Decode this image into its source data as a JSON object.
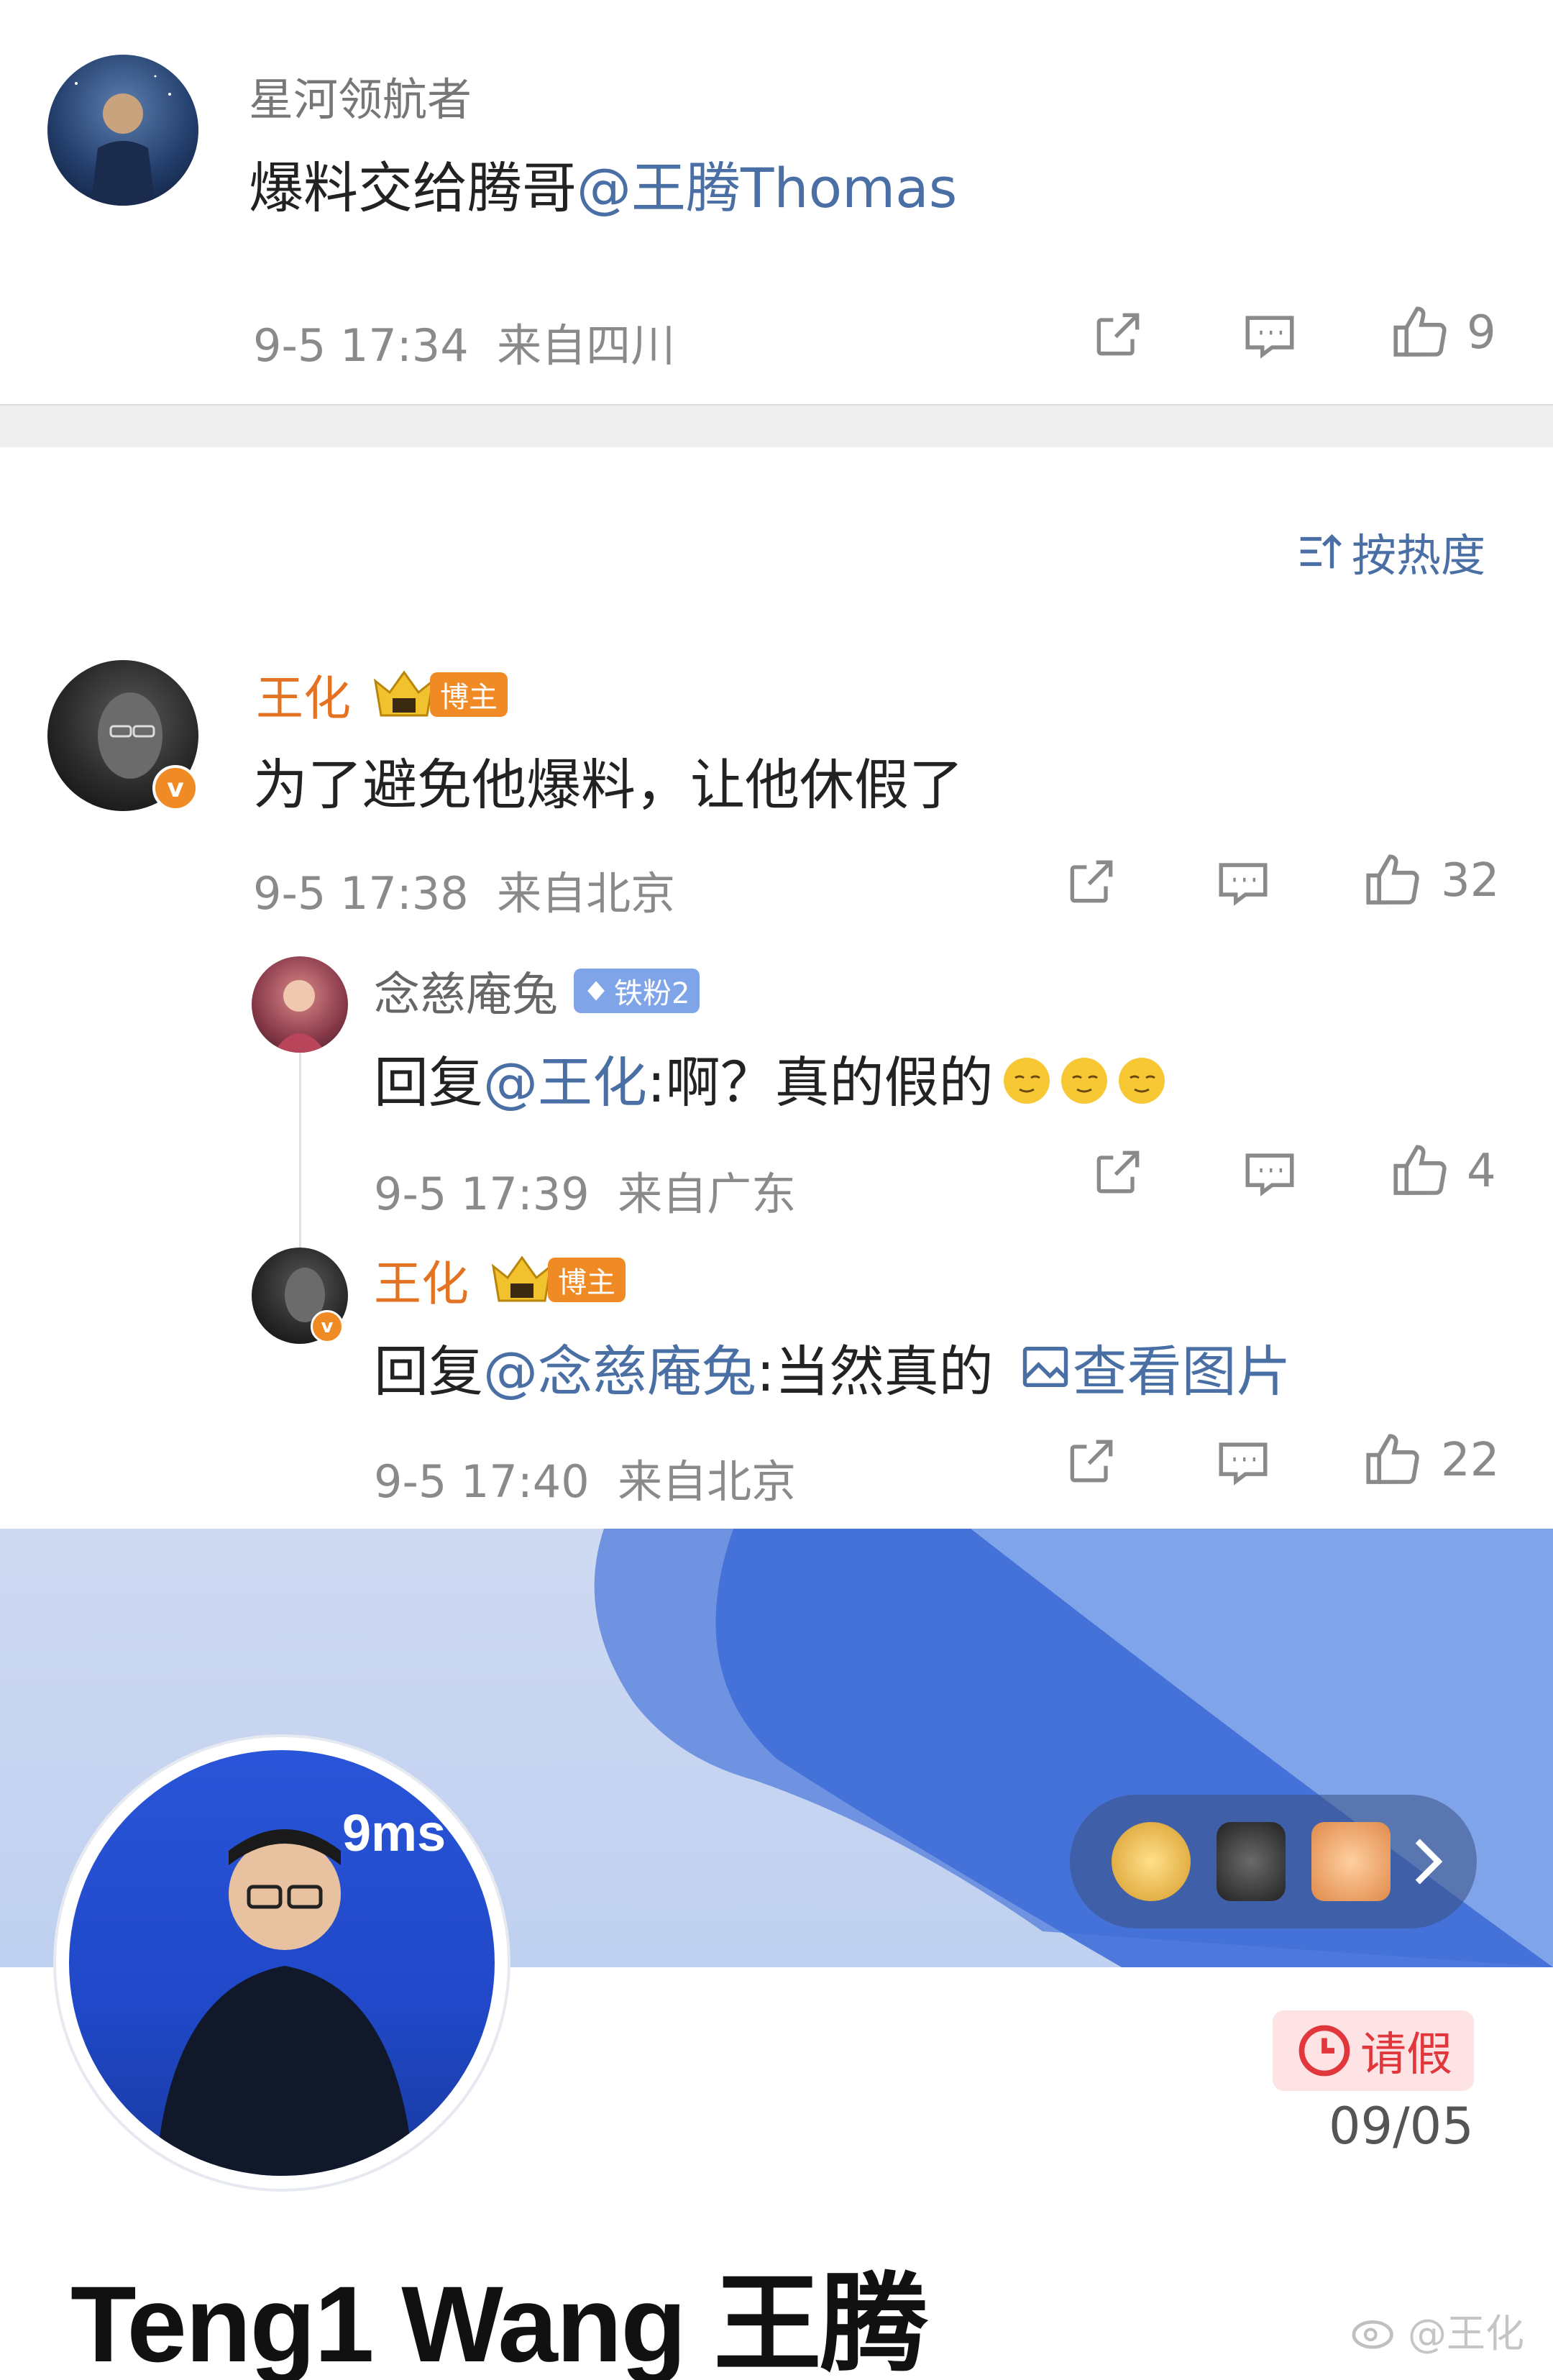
{
  "comment_top": {
    "username": "星河领航者",
    "text": "爆料交给腾哥",
    "mention": "@王腾Thomas",
    "time": "9-5 17:34",
    "location": "来自四川",
    "likes": "9"
  },
  "sort_label": "按热度",
  "comment_main": {
    "username": "王化",
    "badge": "博主",
    "text": "为了避免他爆料，让他休假了",
    "time": "9-5 17:38",
    "location": "来自北京",
    "likes": "32"
  },
  "reply_1": {
    "username": "念慈庵兔",
    "fan_badge": "铁粉2",
    "prefix": "回复",
    "mention": "@王化",
    "text": ":啊？真的假的",
    "time": "9-5 17:39",
    "location": "来自广东",
    "likes": "4"
  },
  "reply_2": {
    "username": "王化",
    "badge": "博主",
    "prefix": "回复",
    "mention": "@念慈庵兔",
    "text": ":当然真的",
    "image_link": "查看图片",
    "time": "9-5 17:40",
    "location": "来自北京",
    "likes": "22"
  },
  "profile": {
    "name": "Teng1 Wang 王腾",
    "status": "请假",
    "status_date": "09/05",
    "watermark": "@王化"
  },
  "colors": {
    "orange": "#e37222",
    "link": "#4a6fa5",
    "gray": "#8a8a8a"
  },
  "icons": [
    "share-icon",
    "comment-icon",
    "like-icon",
    "sort-icon",
    "verified-icon",
    "crown-icon",
    "diamond-icon",
    "image-icon",
    "clock-icon",
    "chevron-right-icon",
    "weibo-icon"
  ]
}
